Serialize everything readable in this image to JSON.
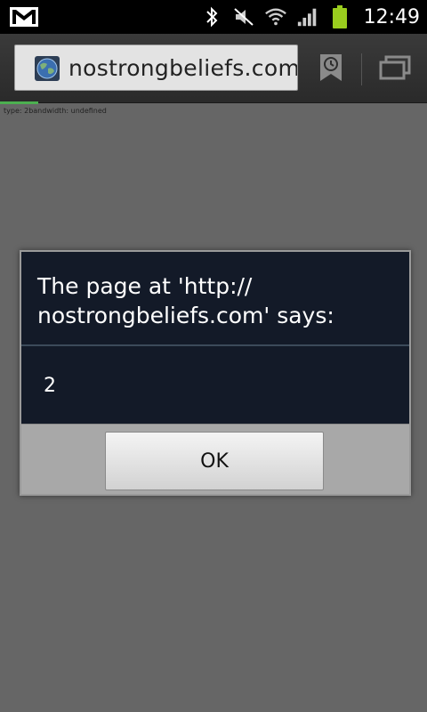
{
  "status_bar": {
    "left_icon": "gmail-icon",
    "icons": [
      "bluetooth-icon",
      "muted-icon",
      "wifi-icon",
      "signal-icon",
      "battery-icon"
    ],
    "time": "12:49"
  },
  "browser": {
    "url": "nostrongbeliefs.com,",
    "favicon": "globe-icon",
    "bookmark_icon": "bookmark-history-icon",
    "tabs_icon": "windows-icon",
    "load_progress": 0.09
  },
  "page": {
    "debug_text": "type: 2bandwidth: undefined"
  },
  "dialog": {
    "title": "The page at 'http:// nostrongbeliefs.com' says:",
    "message": "2",
    "ok_label": "OK"
  },
  "colors": {
    "page_background": "#666666",
    "dialog_background": "#131a28",
    "dialog_footer": "#a8a8a8",
    "progress": "#4caf50",
    "battery": "#9acd1e"
  }
}
